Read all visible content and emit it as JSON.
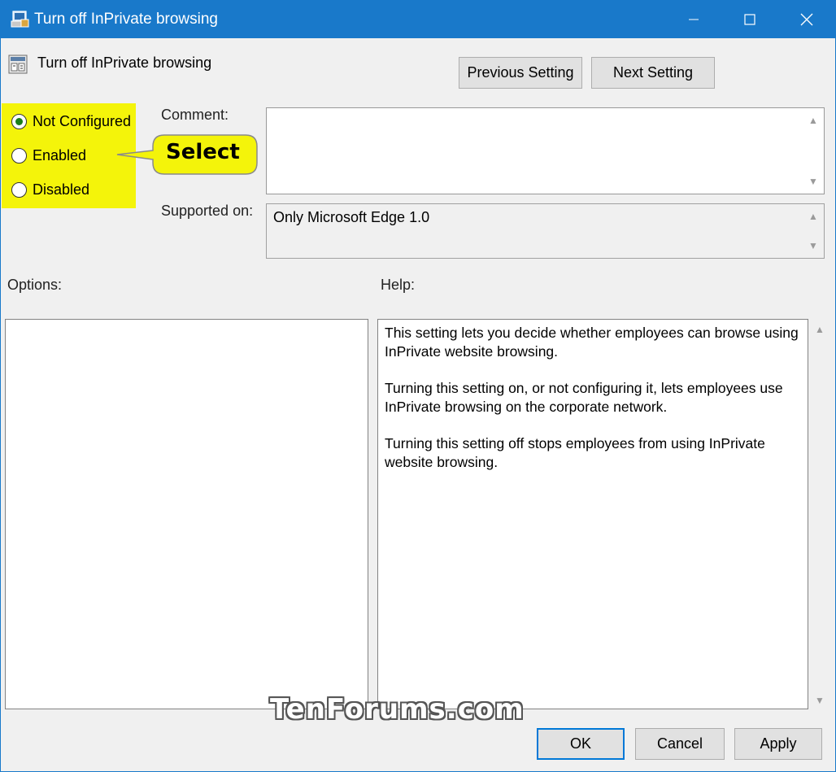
{
  "window": {
    "title": "Turn off InPrivate browsing",
    "minimize_icon": "minimize-icon",
    "maximize_icon": "maximize-icon",
    "close_icon": "close-icon"
  },
  "policy": {
    "name": "Turn off InPrivate browsing",
    "icon": "policy-setting-icon"
  },
  "nav": {
    "previous_label": "Previous Setting",
    "next_label": "Next Setting"
  },
  "state": {
    "options": [
      {
        "label": "Not Configured",
        "selected": true
      },
      {
        "label": "Enabled",
        "selected": false
      },
      {
        "label": "Disabled",
        "selected": false
      }
    ],
    "highlight_color": "#f4f40a"
  },
  "callout": {
    "text": "Select",
    "fill": "#f4f40a"
  },
  "fields": {
    "comment_label": "Comment:",
    "comment_value": "",
    "supported_label": "Supported on:",
    "supported_value": "Only Microsoft Edge 1.0",
    "options_label": "Options:",
    "help_label": "Help:"
  },
  "help": {
    "paragraphs": [
      "This setting lets you decide whether employees can browse using InPrivate website browsing.",
      "Turning this setting on, or not configuring it, lets employees use InPrivate browsing on the corporate network.",
      "Turning this setting off stops employees from using InPrivate website browsing."
    ]
  },
  "footer": {
    "ok_label": "OK",
    "cancel_label": "Cancel",
    "apply_label": "Apply"
  },
  "watermark": "TenForums.com",
  "colors": {
    "titlebar": "#1979ca",
    "ok_border": "#0078d7"
  }
}
